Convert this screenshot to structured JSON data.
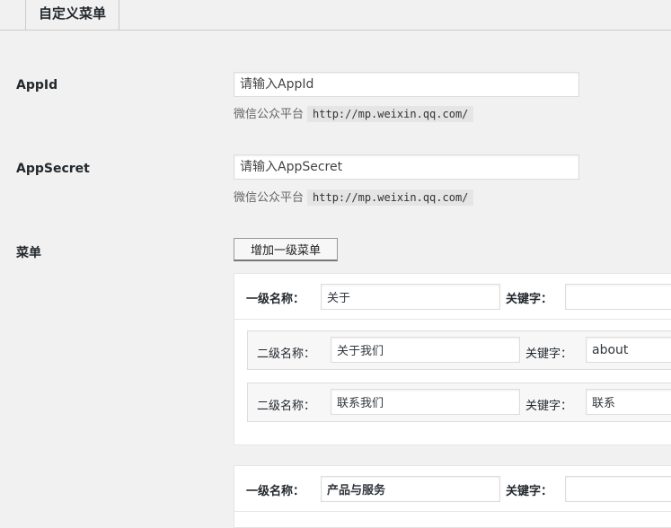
{
  "tab": {
    "label": "自定义菜单"
  },
  "appid": {
    "label": "AppId",
    "placeholder": "请输入AppId",
    "hint": "微信公众平台",
    "link": "http://mp.weixin.qq.com/"
  },
  "appsecret": {
    "label": "AppSecret",
    "placeholder": "请输入AppSecret",
    "hint": "微信公众平台",
    "link": "http://mp.weixin.qq.com/"
  },
  "menu": {
    "label": "菜单",
    "add_button": "增加一级菜单",
    "level1_label": "一级名称：",
    "level2_label": "二级名称：",
    "keyword_label": "关键字：",
    "groups": [
      {
        "name": "关于",
        "keyword": "",
        "children": [
          {
            "name": "关于我们",
            "keyword": "about"
          },
          {
            "name": "联系我们",
            "keyword": "联系"
          }
        ]
      },
      {
        "name": "产品与服务",
        "keyword": ""
      }
    ]
  },
  "colors": {
    "background": "#f1f1f1",
    "panel": "#ffffff",
    "border": "#dddddd"
  }
}
